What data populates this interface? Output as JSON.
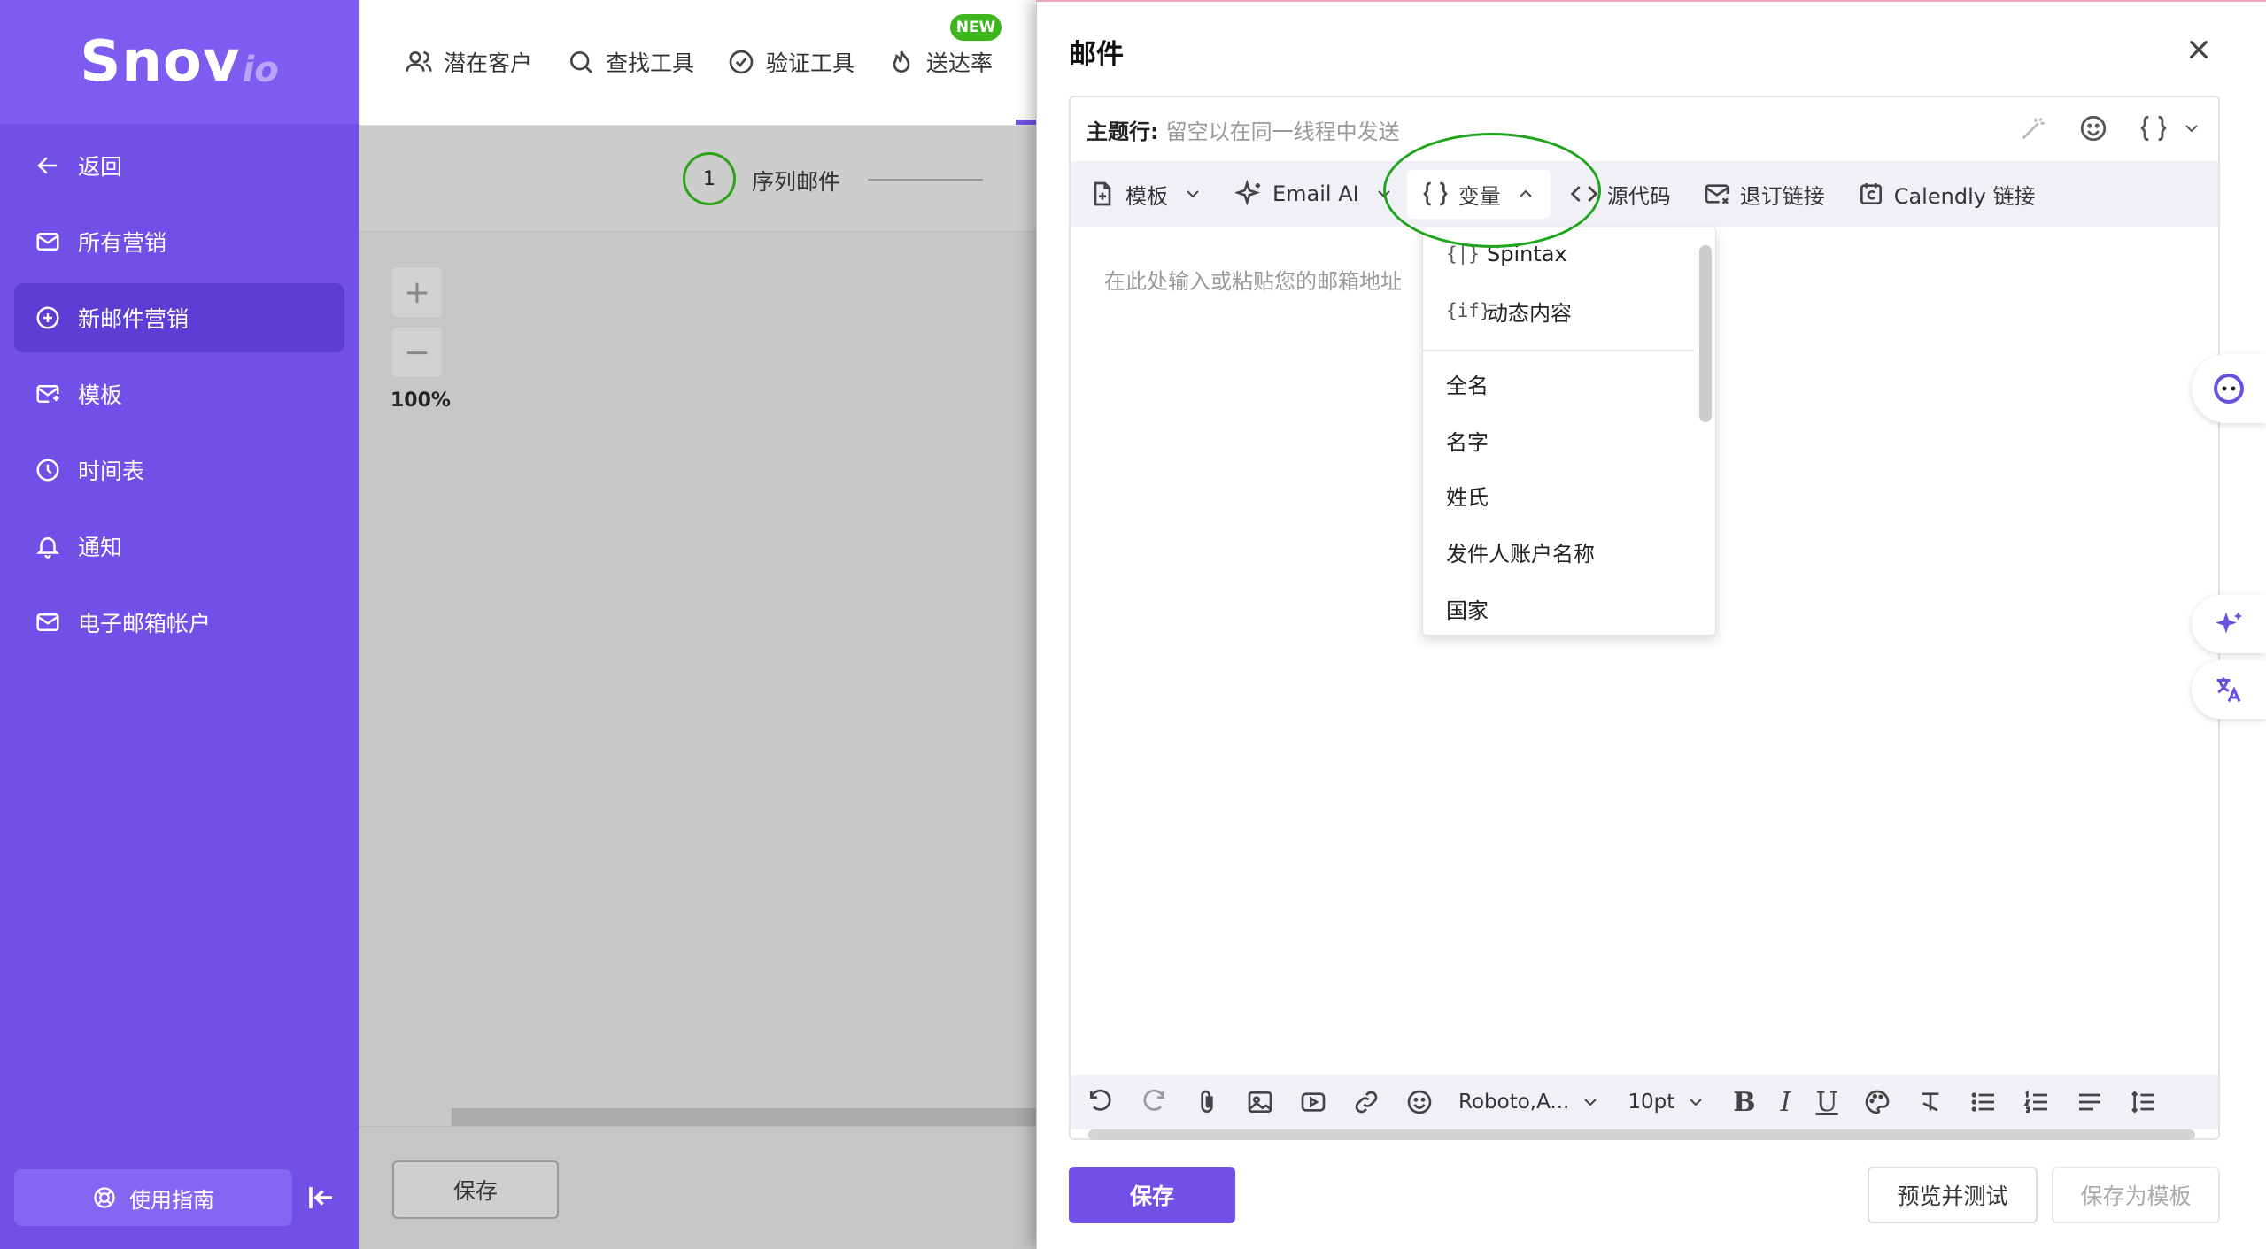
{
  "sidebar": {
    "logo_main": "Snov",
    "logo_sub": "io",
    "items": [
      {
        "label": "返回",
        "icon": "arrow-left-icon"
      },
      {
        "label": "所有营销",
        "icon": "mail-icon"
      },
      {
        "label": "新邮件营销",
        "icon": "plus-circle-icon",
        "active": true
      },
      {
        "label": "模板",
        "icon": "mail-template-icon"
      },
      {
        "label": "时间表",
        "icon": "clock-icon"
      },
      {
        "label": "通知",
        "icon": "bell-icon"
      },
      {
        "label": "电子邮箱帐户",
        "icon": "mail-icon"
      }
    ],
    "guide_label": "使用指南"
  },
  "topnav": {
    "items": [
      {
        "label": "潜在客户",
        "icon": "users-icon"
      },
      {
        "label": "查找工具",
        "icon": "search-icon"
      },
      {
        "label": "验证工具",
        "icon": "check-circle-icon"
      },
      {
        "label": "送达率",
        "icon": "flame-icon"
      }
    ],
    "new_badge": "NEW"
  },
  "canvas": {
    "step_number": "1",
    "step_label": "序列邮件",
    "zoom_plus": "+",
    "zoom_minus": "−",
    "zoom_level": "100%",
    "save_label": "保存"
  },
  "panel": {
    "title": "邮件",
    "subject_label": "主题行:",
    "subject_placeholder": "留空以在同一线程中发送",
    "toolbar": {
      "template": "模板",
      "email_ai": "Email AI",
      "variables": "变量",
      "source": "源代码",
      "unsubscribe": "退订链接",
      "calendly": "Calendly 链接"
    },
    "body_placeholder": "在此处输入或粘贴您的邮箱地址",
    "dropdown": [
      {
        "label": "Spintax",
        "icon": "{|}"
      },
      {
        "label": "动态内容",
        "icon": "{if}"
      },
      {
        "label": "全名"
      },
      {
        "label": "名字"
      },
      {
        "label": "姓氏"
      },
      {
        "label": "发件人账户名称"
      },
      {
        "label": "国家"
      }
    ],
    "format": {
      "font": "Roboto,A...",
      "size": "10pt",
      "bold": "B",
      "italic": "I",
      "underline": "U"
    },
    "save": "保存",
    "preview": "预览并测试",
    "save_template": "保存为模板"
  },
  "colors": {
    "brand": "#7050e6",
    "logo_bg": "#7d5cf0",
    "active_item": "#5b3fd4",
    "new_badge": "#3db51c",
    "annotation": "#1fa51d"
  }
}
